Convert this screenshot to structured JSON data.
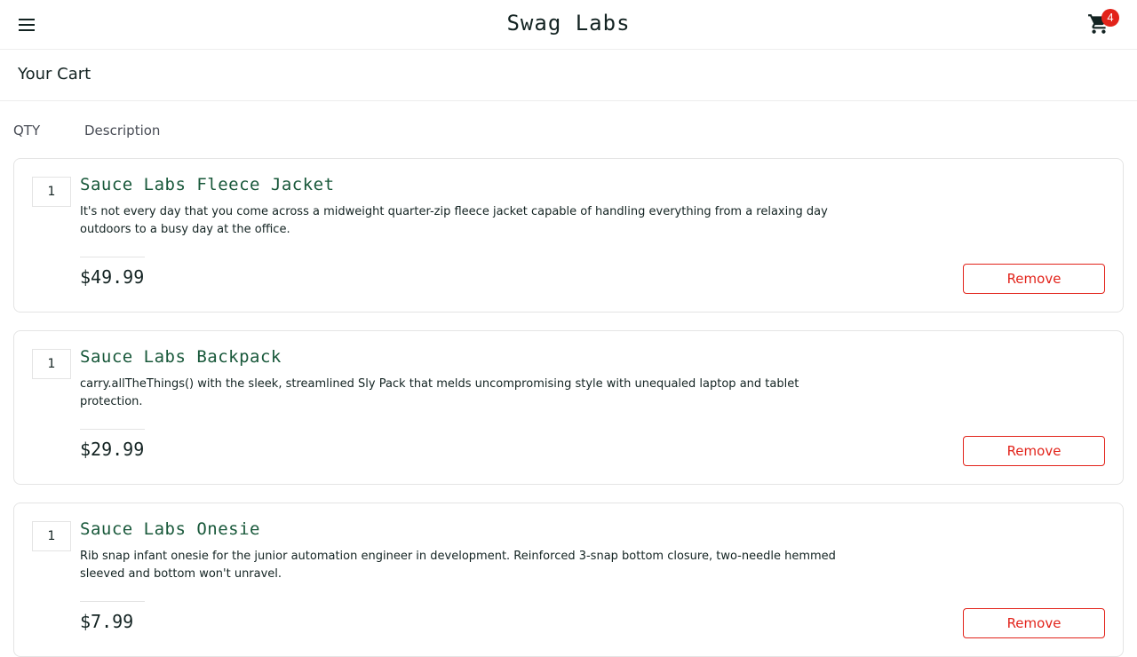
{
  "header": {
    "app_logo": "Swag Labs",
    "menu_icon": "hamburger-menu-icon",
    "cart_icon": "shopping-cart-icon",
    "cart_badge": "4"
  },
  "page": {
    "title": "Your Cart"
  },
  "cart_list": {
    "qty_label": "QTY",
    "desc_label": "Description",
    "items": [
      {
        "quantity": "1",
        "name": "Sauce Labs Fleece Jacket",
        "description": "It's not every day that you come across a midweight quarter-zip fleece jacket capable of handling everything from a relaxing day outdoors to a busy day at the office.",
        "price": "$49.99",
        "remove_label": "Remove"
      },
      {
        "quantity": "1",
        "name": "Sauce Labs Backpack",
        "description": "carry.allTheThings() with the sleek, streamlined Sly Pack that melds uncompromising style with unequaled laptop and tablet protection.",
        "price": "$29.99",
        "remove_label": "Remove"
      },
      {
        "quantity": "1",
        "name": "Sauce Labs Onesie",
        "description": "Rib snap infant onesie for the junior automation engineer in development. Reinforced 3-snap bottom closure, two-needle hemmed sleeved and bottom won't unravel.",
        "price": "$7.99",
        "remove_label": "Remove"
      }
    ]
  },
  "colors": {
    "accent": "#e2231a",
    "item_name": "#18583a",
    "text": "#132322"
  }
}
